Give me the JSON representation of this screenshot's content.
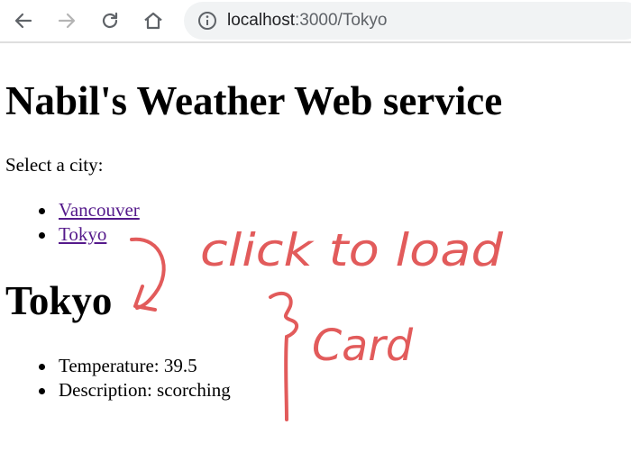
{
  "browser": {
    "back_icon": "arrow-left-icon",
    "forward_icon": "arrow-right-icon",
    "reload_icon": "reload-icon",
    "home_icon": "home-icon",
    "info_icon": "info-icon",
    "url_host": "localhost",
    "url_path": ":3000/Tokyo"
  },
  "page": {
    "title": "Nabil's Weather Web service",
    "select_label": "Select a city:",
    "cities": [
      {
        "label": "Vancouver"
      },
      {
        "label": "Tokyo"
      }
    ],
    "selected_city_title": "Tokyo",
    "details": [
      {
        "label": "Temperature: 39.5"
      },
      {
        "label": "Description: scorching"
      }
    ]
  },
  "annotation": {
    "line1": "click to load",
    "line2": "Card",
    "color": "#e25b5b"
  }
}
